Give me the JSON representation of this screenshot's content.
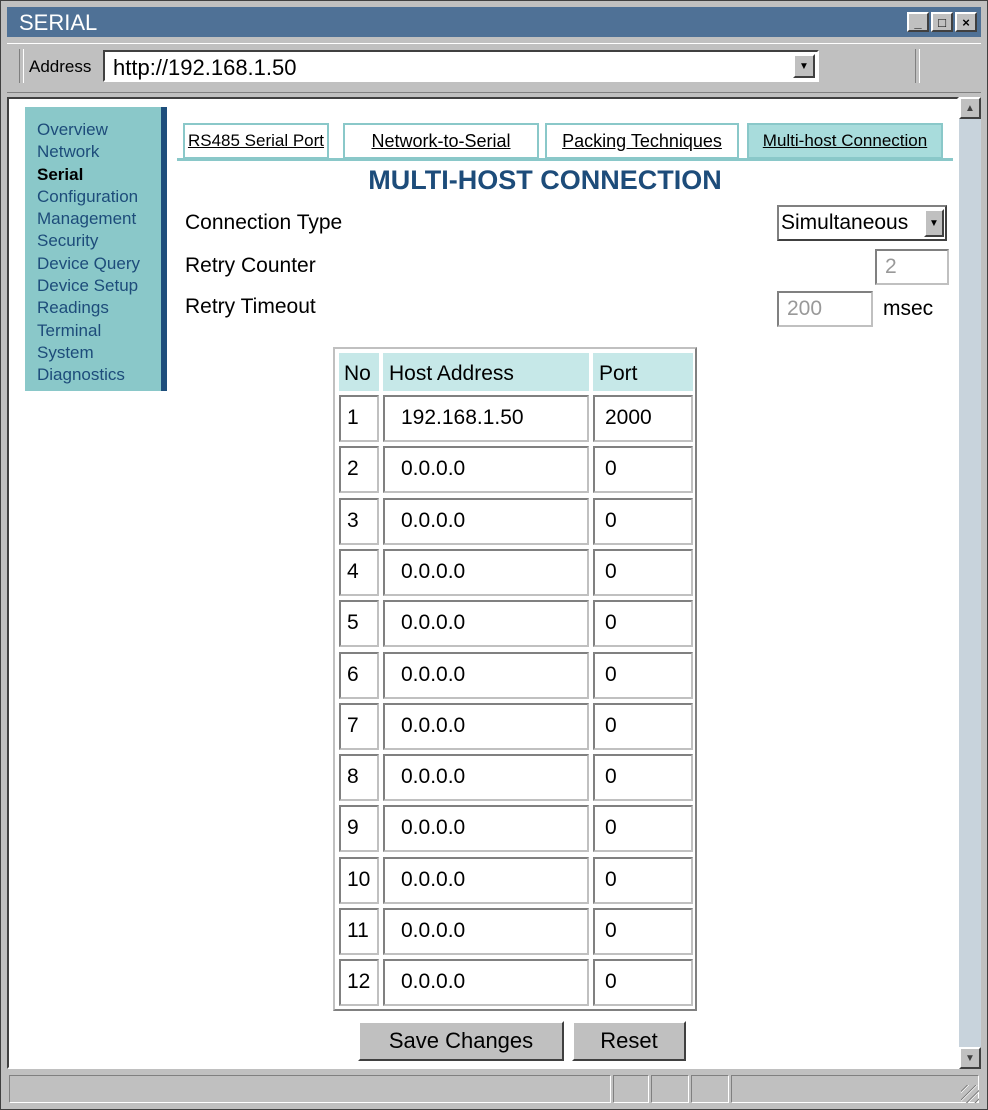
{
  "window": {
    "title": "SERIAL",
    "minimize_glyph": "_",
    "maximize_glyph": "□",
    "close_glyph": "×"
  },
  "address_bar": {
    "label": "Address",
    "url": "http://192.168.1.50"
  },
  "sidebar": {
    "items": [
      {
        "label": "Overview",
        "active": false
      },
      {
        "label": "Network",
        "active": false
      },
      {
        "label": "Serial",
        "active": true
      },
      {
        "label": "Configuration",
        "active": false
      },
      {
        "label": "Management",
        "active": false
      },
      {
        "label": "Security",
        "active": false
      },
      {
        "label": "Device Query",
        "active": false
      },
      {
        "label": "Device Setup",
        "active": false
      },
      {
        "label": "Readings",
        "active": false
      },
      {
        "label": "Terminal",
        "active": false
      },
      {
        "label": "System",
        "active": false
      },
      {
        "label": "Diagnostics",
        "active": false
      }
    ]
  },
  "tabs": [
    {
      "label": "RS485 Serial Port",
      "active": false
    },
    {
      "label": "Network-to-Serial",
      "active": false
    },
    {
      "label": "Packing Techniques",
      "active": false
    },
    {
      "label": "Multi-host Connection",
      "active": true
    }
  ],
  "page_heading": "MULTI-HOST CONNECTION",
  "form": {
    "connection_type": {
      "label": "Connection Type",
      "value": "Simultaneous"
    },
    "retry_counter": {
      "label": "Retry Counter",
      "value": "2"
    },
    "retry_timeout": {
      "label": "Retry Timeout",
      "value": "200",
      "unit": "msec"
    }
  },
  "host_table": {
    "headers": {
      "no": "No",
      "host": "Host Address",
      "port": "Port"
    },
    "rows": [
      {
        "no": "1",
        "host": "192.168.1.50",
        "port": "2000"
      },
      {
        "no": "2",
        "host": "0.0.0.0",
        "port": "0"
      },
      {
        "no": "3",
        "host": "0.0.0.0",
        "port": "0"
      },
      {
        "no": "4",
        "host": "0.0.0.0",
        "port": "0"
      },
      {
        "no": "5",
        "host": "0.0.0.0",
        "port": "0"
      },
      {
        "no": "6",
        "host": "0.0.0.0",
        "port": "0"
      },
      {
        "no": "7",
        "host": "0.0.0.0",
        "port": "0"
      },
      {
        "no": "8",
        "host": "0.0.0.0",
        "port": "0"
      },
      {
        "no": "9",
        "host": "0.0.0.0",
        "port": "0"
      },
      {
        "no": "10",
        "host": "0.0.0.0",
        "port": "0"
      },
      {
        "no": "11",
        "host": "0.0.0.0",
        "port": "0"
      },
      {
        "no": "12",
        "host": "0.0.0.0",
        "port": "0"
      }
    ]
  },
  "buttons": {
    "save": "Save Changes",
    "reset": "Reset"
  },
  "colors": {
    "accent": "#1d4c7a",
    "sidebar_bg": "#8ac8c9",
    "active_tab_bg": "#a8dcdc",
    "header_cell_bg": "#c6e8e8",
    "titlebar_bg": "#4f7196"
  }
}
